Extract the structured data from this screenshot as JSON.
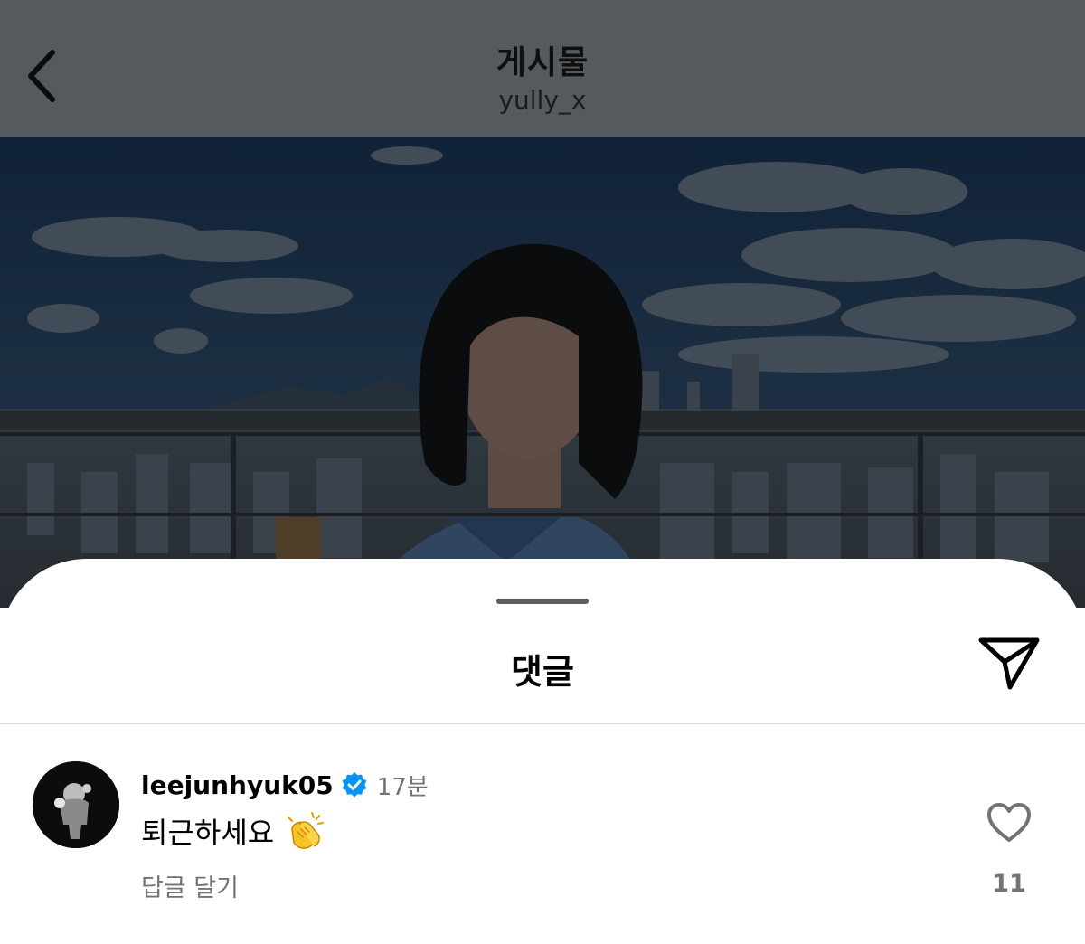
{
  "header": {
    "title": "게시물",
    "username": "yully_x",
    "back_icon": "chevron-left-icon"
  },
  "photo": {
    "alt_subject": "photo-of-woman-on-rooftop",
    "dim_overlay": "#000000"
  },
  "comments_sheet": {
    "title": "댓글",
    "share_icon": "paper-plane-icon",
    "comments": [
      {
        "username": "leejunhyuk05",
        "verified": true,
        "time": "17분",
        "text": "퇴근하세요",
        "emoji": "clapping-hands-emoji",
        "reply_label": "답글 달기",
        "like_count": "11",
        "like_icon": "heart-outline-icon"
      }
    ]
  },
  "colors": {
    "header_bg": "#555a5e",
    "verified_blue": "#0095f6",
    "secondary_text": "#737373",
    "sheet_bg": "#ffffff"
  }
}
